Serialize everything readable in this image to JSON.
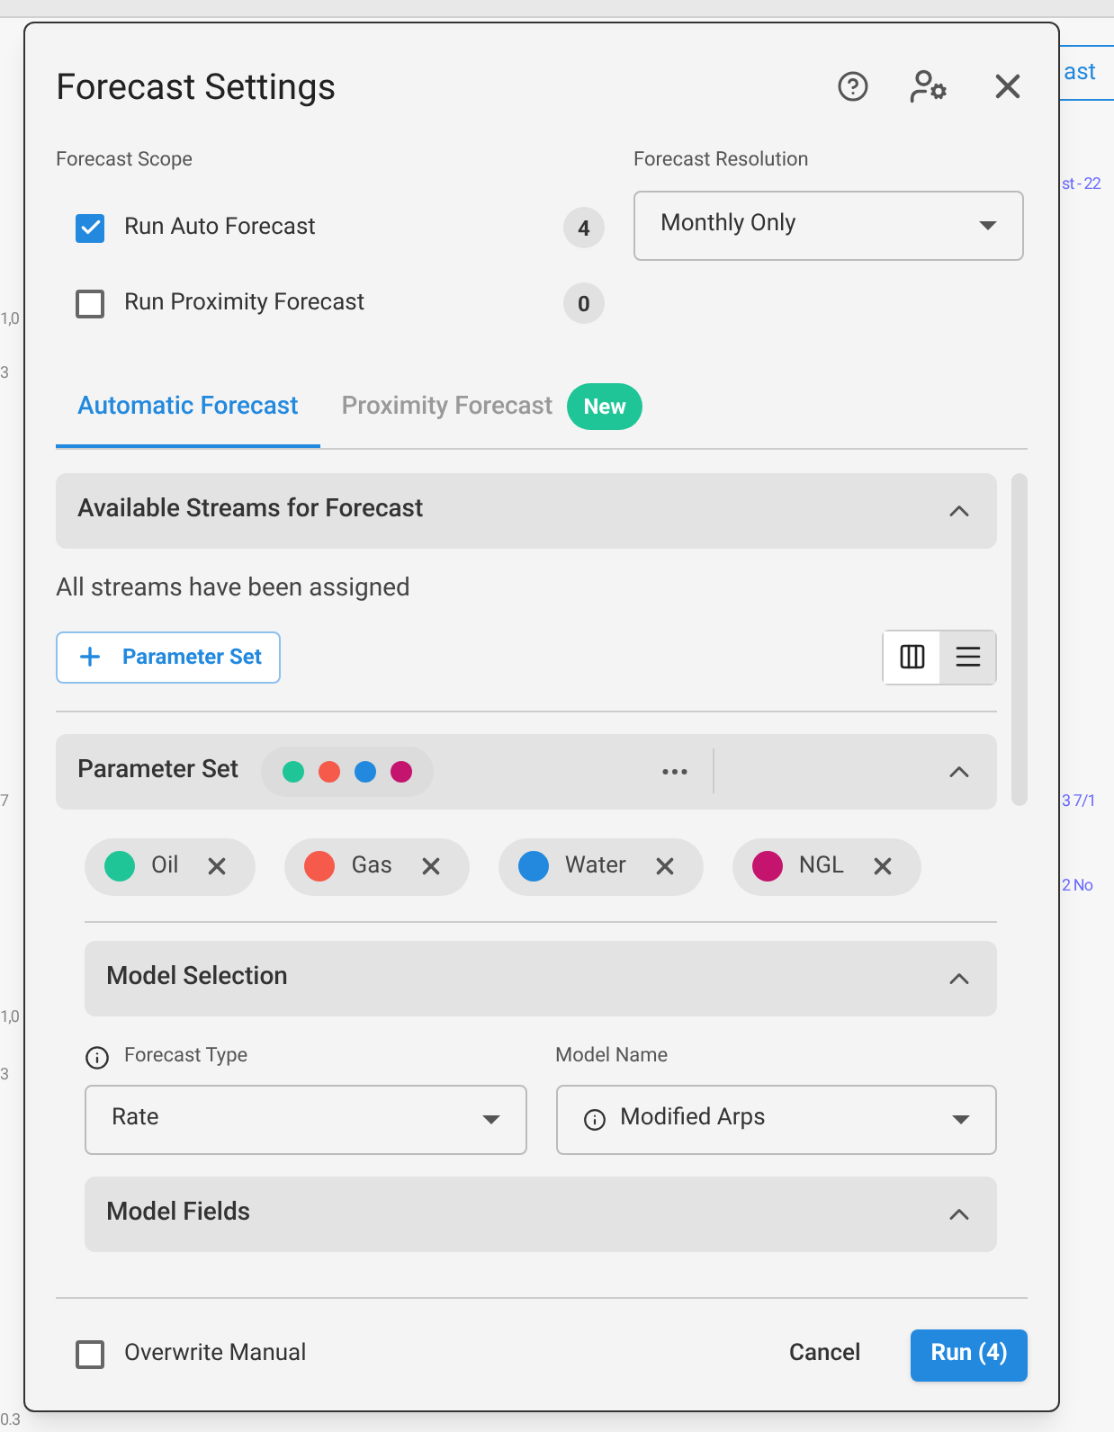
{
  "background": {
    "button": "ast",
    "left_labels": [
      "1,0",
      "3",
      "7",
      "1,0",
      "3",
      "0.3"
    ],
    "right_labels": [
      "st - 22",
      "3  7/1",
      "2  No"
    ]
  },
  "dialog": {
    "title": "Forecast Settings"
  },
  "scope": {
    "label": "Forecast Scope",
    "options": [
      {
        "label": "Run Auto Forecast",
        "checked": true,
        "count": "4"
      },
      {
        "label": "Run Proximity Forecast",
        "checked": false,
        "count": "0"
      }
    ]
  },
  "resolution": {
    "label": "Forecast Resolution",
    "value": "Monthly Only"
  },
  "tabs": [
    {
      "label": "Automatic Forecast",
      "selected": true
    },
    {
      "label": "Proximity Forecast",
      "selected": false,
      "badge": "New"
    }
  ],
  "available_streams": {
    "title": "Available Streams for Forecast",
    "expanded": true,
    "message": "All streams have been assigned",
    "add_button": "Parameter Set",
    "views": [
      {
        "kind": "columns",
        "selected": false
      },
      {
        "kind": "rows",
        "selected": true
      }
    ]
  },
  "parameter_set": {
    "title": "Parameter Set",
    "expanded": true,
    "streams": [
      {
        "name": "Oil",
        "color": "#1fc597"
      },
      {
        "name": "Gas",
        "color": "#f55a4a"
      },
      {
        "name": "Water",
        "color": "#2289de"
      },
      {
        "name": "NGL",
        "color": "#c4146e"
      }
    ],
    "model_selection": {
      "title": "Model Selection",
      "expanded": true,
      "forecast_type": {
        "label": "Forecast Type",
        "value": "Rate"
      },
      "model_name": {
        "label": "Model Name",
        "value": "Modified Arps"
      }
    },
    "model_fields": {
      "title": "Model Fields",
      "expanded": true
    }
  },
  "footer": {
    "overwrite": {
      "label": "Overwrite Manual",
      "checked": false
    },
    "cancel": "Cancel",
    "run": "Run (4)"
  }
}
